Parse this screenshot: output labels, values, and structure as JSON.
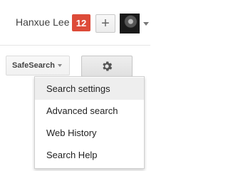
{
  "header": {
    "user_name": "Hanxue Lee",
    "notification_count": "12",
    "share_icon_glyph": "+",
    "avatar_icon": "user-avatar-photo",
    "badge_color": "#dd4b39"
  },
  "toolbar": {
    "safesearch_label": "SafeSearch",
    "settings_icon": "gear-icon"
  },
  "settings_menu": {
    "items": [
      {
        "label": "Search settings",
        "highlighted": true
      },
      {
        "label": "Advanced search",
        "highlighted": false
      },
      {
        "label": "Web History",
        "highlighted": false
      },
      {
        "label": "Search Help",
        "highlighted": false
      }
    ]
  }
}
